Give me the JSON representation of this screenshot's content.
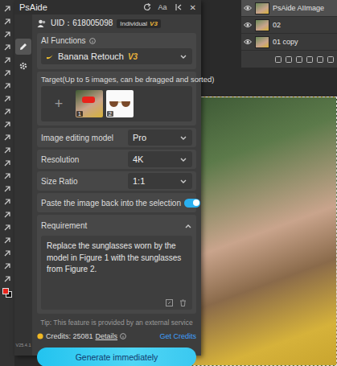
{
  "header": {
    "title": "PsAide",
    "buttons": [
      "Aa",
      "✕"
    ]
  },
  "sidebar": [
    {
      "kind": "edit",
      "selected": true
    },
    {
      "kind": "settings",
      "selected": false
    }
  ],
  "version": "V25.4.1",
  "account": {
    "uid": "UID：618005098",
    "plan": "Individual",
    "plan_version": "V3"
  },
  "ai_functions": {
    "label": "AI Functions",
    "value": "Banana Retouch",
    "version": "V3"
  },
  "target": {
    "label": "Target(Up to 5 images, can be dragged and sorted)",
    "add": "+",
    "images": [
      {
        "index": "1",
        "kind": "photo"
      },
      {
        "index": "2",
        "kind": "sunglasses"
      }
    ]
  },
  "settings": [
    {
      "kind": "select",
      "label": "Image editing model",
      "value": "Pro"
    },
    {
      "kind": "select",
      "label": "Resolution",
      "value": "4K"
    },
    {
      "kind": "select",
      "label": "Size Ratio",
      "value": "1:1"
    },
    {
      "kind": "toggle",
      "label": "Paste the image back into the selection",
      "on": true
    }
  ],
  "requirement": {
    "label": "Requirement",
    "expanded": true,
    "text": "Replace the sunglasses worn by the model in Figure 1 with the sunglasses from Figure 2."
  },
  "tip": "Tip: This feature is provided by an external service",
  "credits": {
    "label": "Credits: 25081",
    "details": "Details",
    "get": "Get Credits"
  },
  "generate_button": "Generate immediately",
  "layers": [
    {
      "name": "PsAide AIImage",
      "selected": true
    },
    {
      "name": "02",
      "selected": false
    },
    {
      "name": "01 copy",
      "selected": false
    }
  ]
}
